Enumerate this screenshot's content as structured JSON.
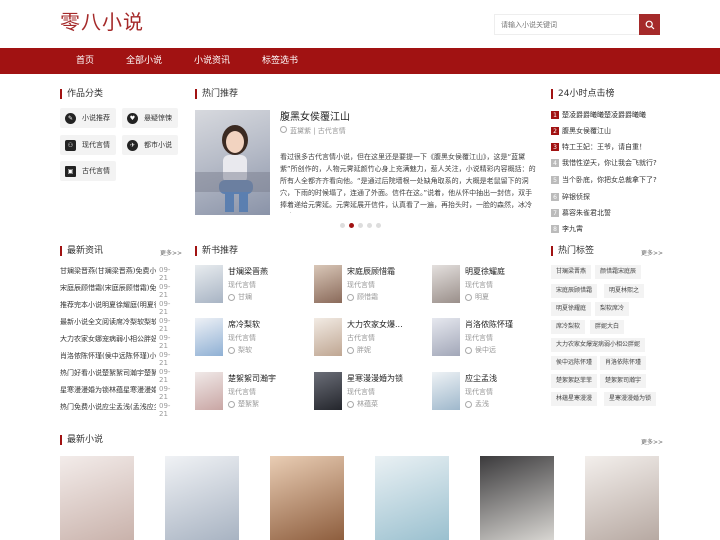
{
  "header": {
    "logo": "零八小说",
    "search_placeholder": "请输入小说关键词",
    "search_icon": "search-icon"
  },
  "nav": [
    "首页",
    "全部小说",
    "小说资讯",
    "标签选书"
  ],
  "categories": {
    "title": "作品分类",
    "items": [
      {
        "label": "小说推荐",
        "icon": "chat-icon"
      },
      {
        "label": "悬疑惊悚",
        "icon": "heart-icon"
      },
      {
        "label": "现代言情",
        "icon": "user-group-icon"
      },
      {
        "label": "都市小说",
        "icon": "compass-icon"
      },
      {
        "label": "古代言情",
        "icon": "book-icon"
      }
    ]
  },
  "hot": {
    "title": "热门推荐",
    "book_title": "腹黑女侯覆江山",
    "book_meta": "蓝黛紫 | 古代言情",
    "desc": "看过很多古代言情小说，但在这里还是要提一下《腹黑女侯覆江山》，这是“蓝黛紫”所创作的，人物元霁延颜竹心身上充满魅力，惹人关注，小说精彩内容概括：的所有人全都齐齐看向他。“是通过后院墙根一处缺角取系的，大概是老鼠留下的洞穴，下雨的时候塌了，连通了外面。信件在这。”说着，他从怀中抽出一封信，双手捧着递给元霁延。元霁延展开信件，认真看了一遍，再抬头时，一脸的森然，冰冷无�...",
    "dots": 5,
    "active_dot": 1
  },
  "rank": {
    "title": "24小时点击榜",
    "items": [
      "楚凌爵爵曦曦楚凌爵爵曦曦",
      "腹黑女侯覆江山",
      "特工王妃：王爷，请自重！",
      "我惜性逆天，你让我会飞就行?",
      "当个卧底，你把女总裁拿下了?",
      "碎银侦探",
      "慕容朱雀君北誓",
      "李九霄"
    ]
  },
  "news": {
    "title": "最新资讯",
    "more": "更多>>",
    "items": [
      {
        "t": "甘斓梁晋燕(甘斓梁晋燕)免费小说",
        "d": "09-21"
      },
      {
        "t": "宋庭辰顾惜霜(宋庭辰顾惜霜)免费",
        "d": "09-21"
      },
      {
        "t": "推荐完本小说明夏徐耀庭(明夏徐耀",
        "d": "09-21"
      },
      {
        "t": "最新小说全文阅读席冷梨软梨软",
        "d": "09-21"
      },
      {
        "t": "大力农家女娜宠病弱小相公胖妞",
        "d": "09-21"
      },
      {
        "t": "肖洛侬陈怀瑾(侯中远陈怀瑾)小说",
        "d": "09-21"
      },
      {
        "t": "热门好看小说楚絮絮司瀚宇楚絮絮",
        "d": "09-21"
      },
      {
        "t": "星寒漫漫婚为锁林蕴星寒漫漫婚为",
        "d": "09-21"
      },
      {
        "t": "热门免费小说应尘孟浅(孟浅应尘)",
        "d": "09-21"
      }
    ]
  },
  "new_books": {
    "title": "新书推荐",
    "items": [
      {
        "title": "甘斓梁晋燕",
        "cat": "现代言情",
        "author": "甘斓"
      },
      {
        "title": "宋庭辰顾惜霜",
        "cat": "现代言情",
        "author": "顾惜霜"
      },
      {
        "title": "明夏徐耀庭",
        "cat": "现代言情",
        "author": "明夏"
      },
      {
        "title": "席冷梨软",
        "cat": "现代言情",
        "author": "梨软"
      },
      {
        "title": "大力农家女爆...",
        "cat": "古代言情",
        "author": "胖妮"
      },
      {
        "title": "肖洛侬陈怀瑾",
        "cat": "现代言情",
        "author": "侯中远"
      },
      {
        "title": "楚絮絮司瀚宇",
        "cat": "现代言情",
        "author": "楚絮絮"
      },
      {
        "title": "星寒漫漫婚为锁",
        "cat": "现代言情",
        "author": "林蕴菜"
      },
      {
        "title": "应尘孟浅",
        "cat": "现代言情",
        "author": "孟浅"
      }
    ]
  },
  "tags": {
    "title": "热门标签",
    "more": "更多>>",
    "items": [
      "甘斓梁晋燕",
      "颜惜霜宋庭辰",
      "宋庭辰顾惜霜",
      "明夏林熙之",
      "明夏徐耀庭",
      "梨软席冷",
      "席冷梨软",
      "胖妮大白",
      "大力农家女爆宠病弱小相公胖妮",
      "侯中远陈怀瑾",
      "肖洛依陈怀瑾",
      "楚絮絮赵菲菲",
      "楚絮絮司瀚宇",
      "林蕴星寒漫漫",
      "星寒漫漫婚为锁"
    ]
  },
  "latest": {
    "title": "最新小说",
    "more": "更多>>"
  }
}
